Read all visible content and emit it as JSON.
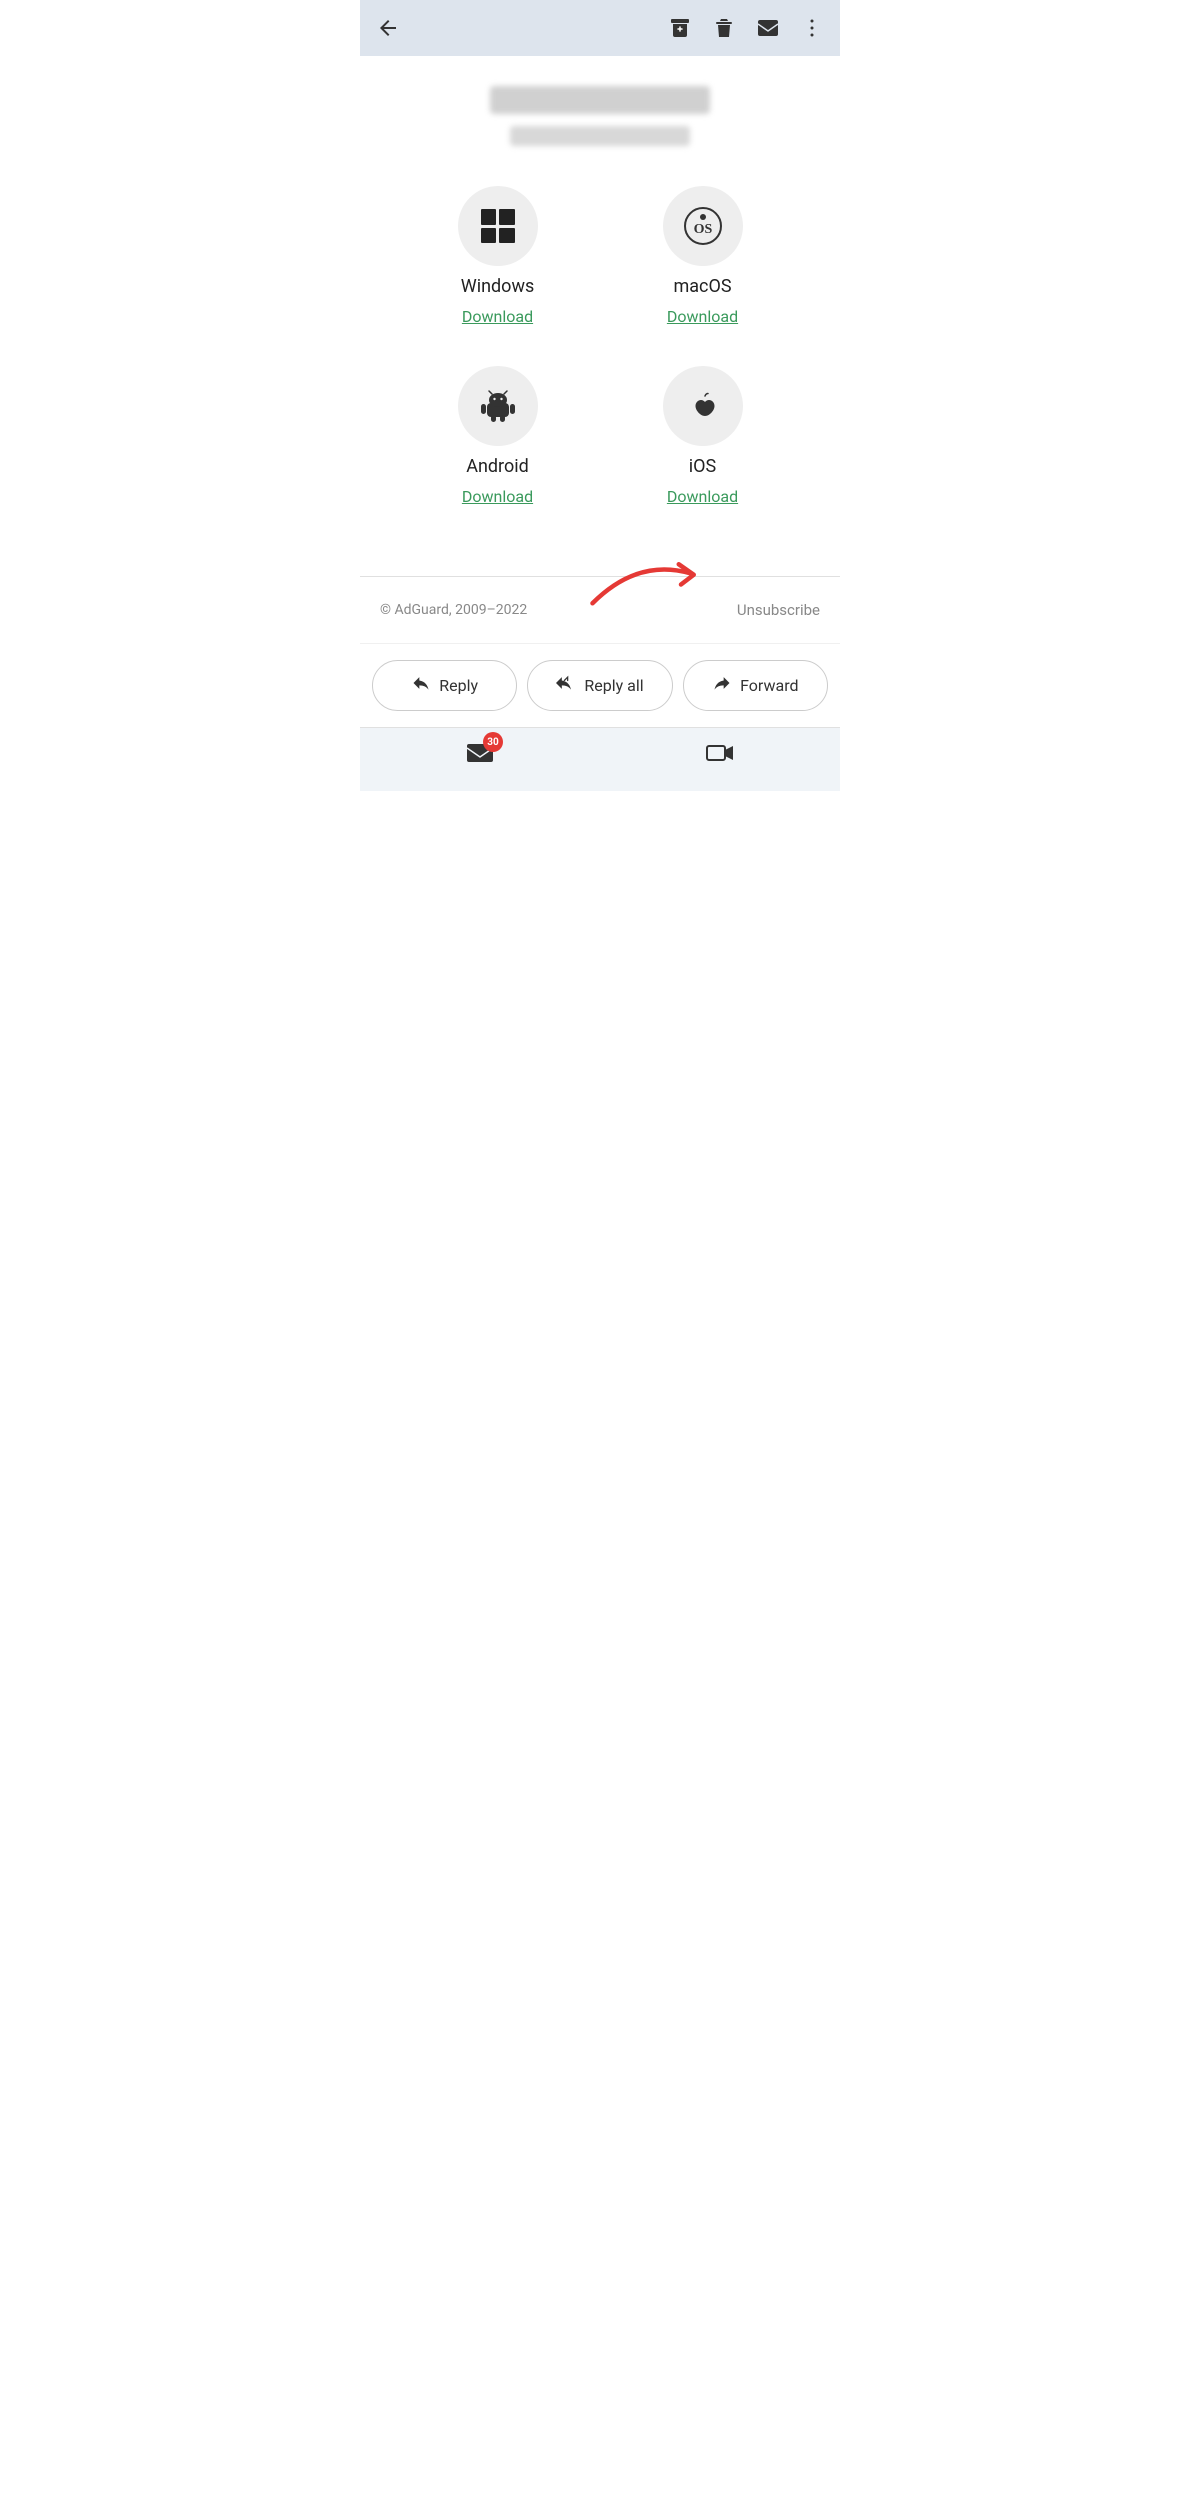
{
  "toolbar": {
    "back_label": "←",
    "archive_icon": "archive-icon",
    "delete_icon": "delete-icon",
    "mail_icon": "mail-icon",
    "more_icon": "more-icon"
  },
  "email": {
    "blurred_title": "",
    "blurred_subtitle": "",
    "platforms": [
      {
        "id": "windows",
        "name": "Windows",
        "download_label": "Download",
        "icon_type": "windows"
      },
      {
        "id": "macos",
        "name": "macOS",
        "download_label": "Download",
        "icon_type": "macos"
      },
      {
        "id": "android",
        "name": "Android",
        "download_label": "Download",
        "icon_type": "android"
      },
      {
        "id": "ios",
        "name": "iOS",
        "download_label": "Download",
        "icon_type": "ios"
      }
    ],
    "footer": {
      "copyright": "© AdGuard, 2009–2022",
      "unsubscribe": "Unsubscribe"
    }
  },
  "actions": {
    "reply_label": "Reply",
    "reply_all_label": "Reply all",
    "forward_label": "Forward"
  },
  "bottom_nav": {
    "mail_badge": "30"
  }
}
